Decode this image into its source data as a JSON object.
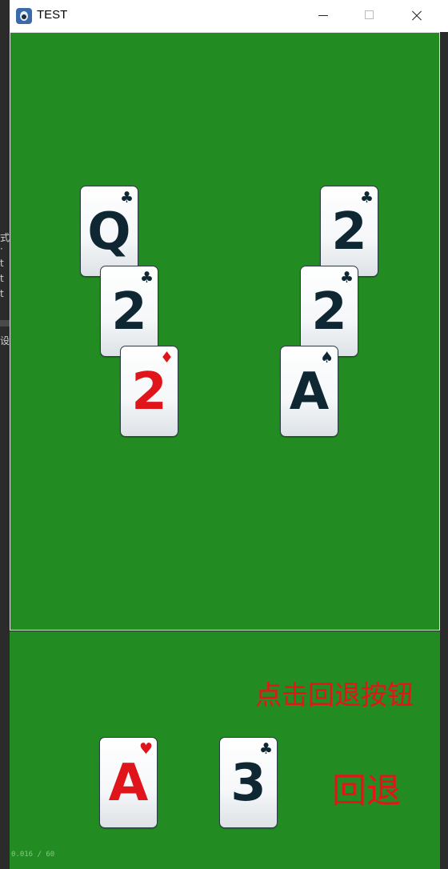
{
  "window": {
    "title": "TEST",
    "minimize_label": "",
    "maximize_label": "",
    "close_label": ""
  },
  "background_fragments": [
    "式",
    "·",
    "t",
    "t",
    "t",
    "设"
  ],
  "colors": {
    "table_green": "#228B22",
    "red_card": "#e0141b",
    "black_card": "#0f2633",
    "hint_red": "#e8121a"
  },
  "board": {
    "left_stack": [
      {
        "rank": "Q",
        "suit": "♣",
        "suit_name": "clubs",
        "color": "black"
      },
      {
        "rank": "2",
        "suit": "♣",
        "suit_name": "clubs",
        "color": "black"
      },
      {
        "rank": "2",
        "suit": "♦",
        "suit_name": "diamonds",
        "color": "red"
      }
    ],
    "right_stack": [
      {
        "rank": "2",
        "suit": "♣",
        "suit_name": "clubs",
        "color": "black"
      },
      {
        "rank": "2",
        "suit": "♣",
        "suit_name": "clubs",
        "color": "black"
      },
      {
        "rank": "A",
        "suit": "♠",
        "suit_name": "spades",
        "color": "black"
      }
    ]
  },
  "hand": {
    "cards": [
      {
        "rank": "A",
        "suit": "♥",
        "suit_name": "hearts",
        "color": "red"
      },
      {
        "rank": "3",
        "suit": "♣",
        "suit_name": "clubs",
        "color": "black"
      }
    ],
    "hint_text": "点击回退按钮",
    "undo_label": "回退"
  },
  "fps_text": "0.016 / 60"
}
